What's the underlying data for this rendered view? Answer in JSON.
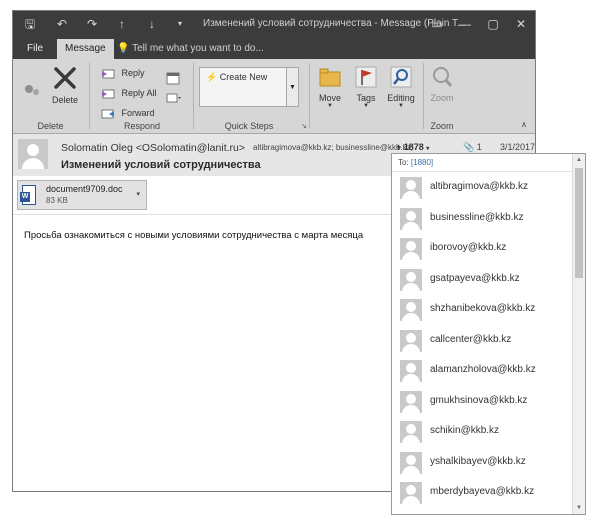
{
  "window": {
    "title": "Изменений  условий сотрудничества - Message (Plain T...",
    "qat": {
      "save_icon": "save-icon",
      "undo_icon": "undo-icon",
      "redo_icon": "redo-icon",
      "up_icon": "up-arrow-icon",
      "down_icon": "down-arrow-icon",
      "customize_icon": "customize-icon"
    },
    "controls": {
      "restore": "▭",
      "minimize": "—",
      "maximize": "▢",
      "close": "✕"
    }
  },
  "tabs": {
    "file": "File",
    "message": "Message",
    "tell_me": "Tell me what you want to do..."
  },
  "ribbon": {
    "delete_group": {
      "delete_label": "Delete",
      "group_label": "Delete"
    },
    "respond_group": {
      "reply": "Reply",
      "reply_all": "Reply All",
      "forward": "Forward",
      "group_label": "Respond"
    },
    "quick_steps": {
      "create_new": "Create New",
      "group_label": "Quick Steps"
    },
    "move": "Move",
    "tags": "Tags",
    "editing": "Editing",
    "zoom": {
      "label": "Zoom",
      "group_label": "Zoom"
    },
    "accent_color": "#c0392b"
  },
  "message": {
    "sender": "Solomatin Oleg <OSolomatin@lanit.ru>",
    "subject": "Изменений  условий сотрудничества",
    "to_summary": "altibragimova@kkb.kz; businessline@kkb.kz;",
    "more_count": "+ 1878",
    "attachment_count": "1",
    "date": "3/1/2017",
    "attachment": {
      "name": "document9709.doc",
      "size": "83 KB"
    },
    "body": "Просьба ознакомиться с новыми условиями сотрудничества с марта месяца"
  },
  "recipients_popup": {
    "to_label": "To:",
    "count": "[1880]",
    "recipients": [
      "altibragimova@kkb.kz",
      "businessline@kkb.kz",
      "iborovoy@kkb.kz",
      "gsatpayeva@kkb.kz",
      "shzhanibekova@kkb.kz",
      "callcenter@kkb.kz",
      "alamanzholova@kkb.kz",
      "gmukhsinova@kkb.kz",
      "schikin@kkb.kz",
      "yshalkibayev@kkb.kz",
      "mberdybayeva@kkb.kz"
    ]
  }
}
